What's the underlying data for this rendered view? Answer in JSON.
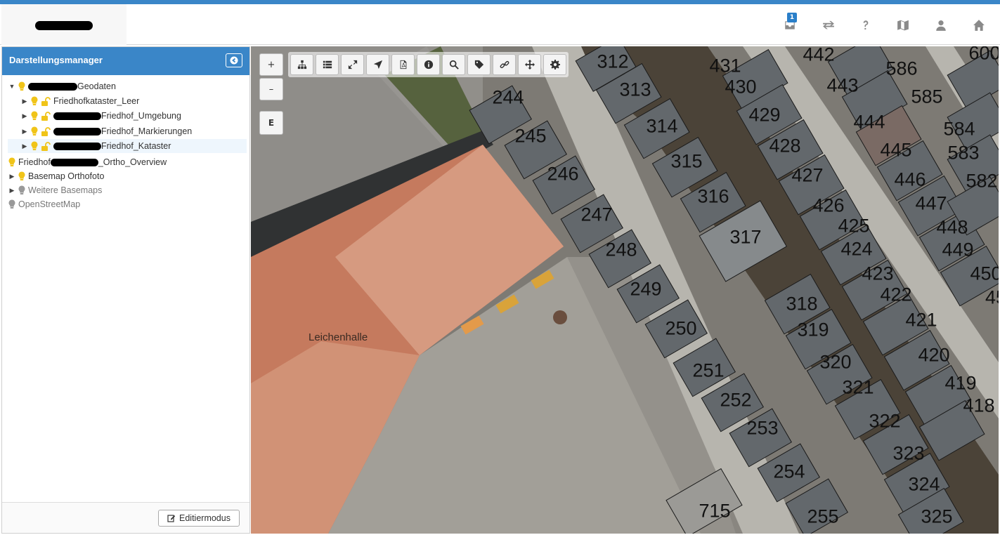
{
  "header": {
    "notifications_count": "1",
    "icons": [
      "inbox-icon",
      "swap-icon",
      "help-icon",
      "map-icon",
      "user-icon",
      "home-icon"
    ]
  },
  "sidebar": {
    "title": "Darstellungsmanager",
    "tree": {
      "root_label": "Geodaten",
      "children": [
        {
          "label": "Friedhofkataster_Leer"
        },
        {
          "label": "Friedhof_Umgebung"
        },
        {
          "label": "Friedhof_Markierungen"
        },
        {
          "label": "Friedhof_Kataster"
        }
      ],
      "overview": {
        "prefix": "Friedhof",
        "suffix": "_Ortho_Overview"
      },
      "basemap_ortho": "Basemap Orthofoto",
      "weitere_basemaps": "Weitere Basemaps",
      "osm": "OpenStreetMap"
    },
    "edit_button": "Editiermodus"
  },
  "map": {
    "zoom_in": "+",
    "zoom_out": "–",
    "e_button": "E",
    "toolbar_icons": [
      "sitemap-icon",
      "list-icon",
      "expand-icon",
      "locate-icon",
      "pdf-icon",
      "info-icon",
      "search-icon",
      "tag-icon",
      "link-icon",
      "move-icon",
      "gear-icon"
    ],
    "building_label": "Leichenhalle",
    "grave_numbers": [
      "312",
      "431",
      "442",
      "586",
      "600",
      "244",
      "313",
      "430",
      "443",
      "585",
      "245",
      "314",
      "429",
      "444",
      "584",
      "246",
      "315",
      "428",
      "445",
      "583",
      "247",
      "316",
      "427",
      "446",
      "582",
      "248",
      "317",
      "426",
      "447",
      "249",
      "425",
      "448",
      "250",
      "424",
      "449",
      "251",
      "318",
      "423",
      "450",
      "252",
      "319",
      "422",
      "421",
      "253",
      "320",
      "420",
      "254",
      "321",
      "419",
      "715",
      "322",
      "418",
      "255",
      "323",
      "324",
      "325",
      "45"
    ]
  }
}
